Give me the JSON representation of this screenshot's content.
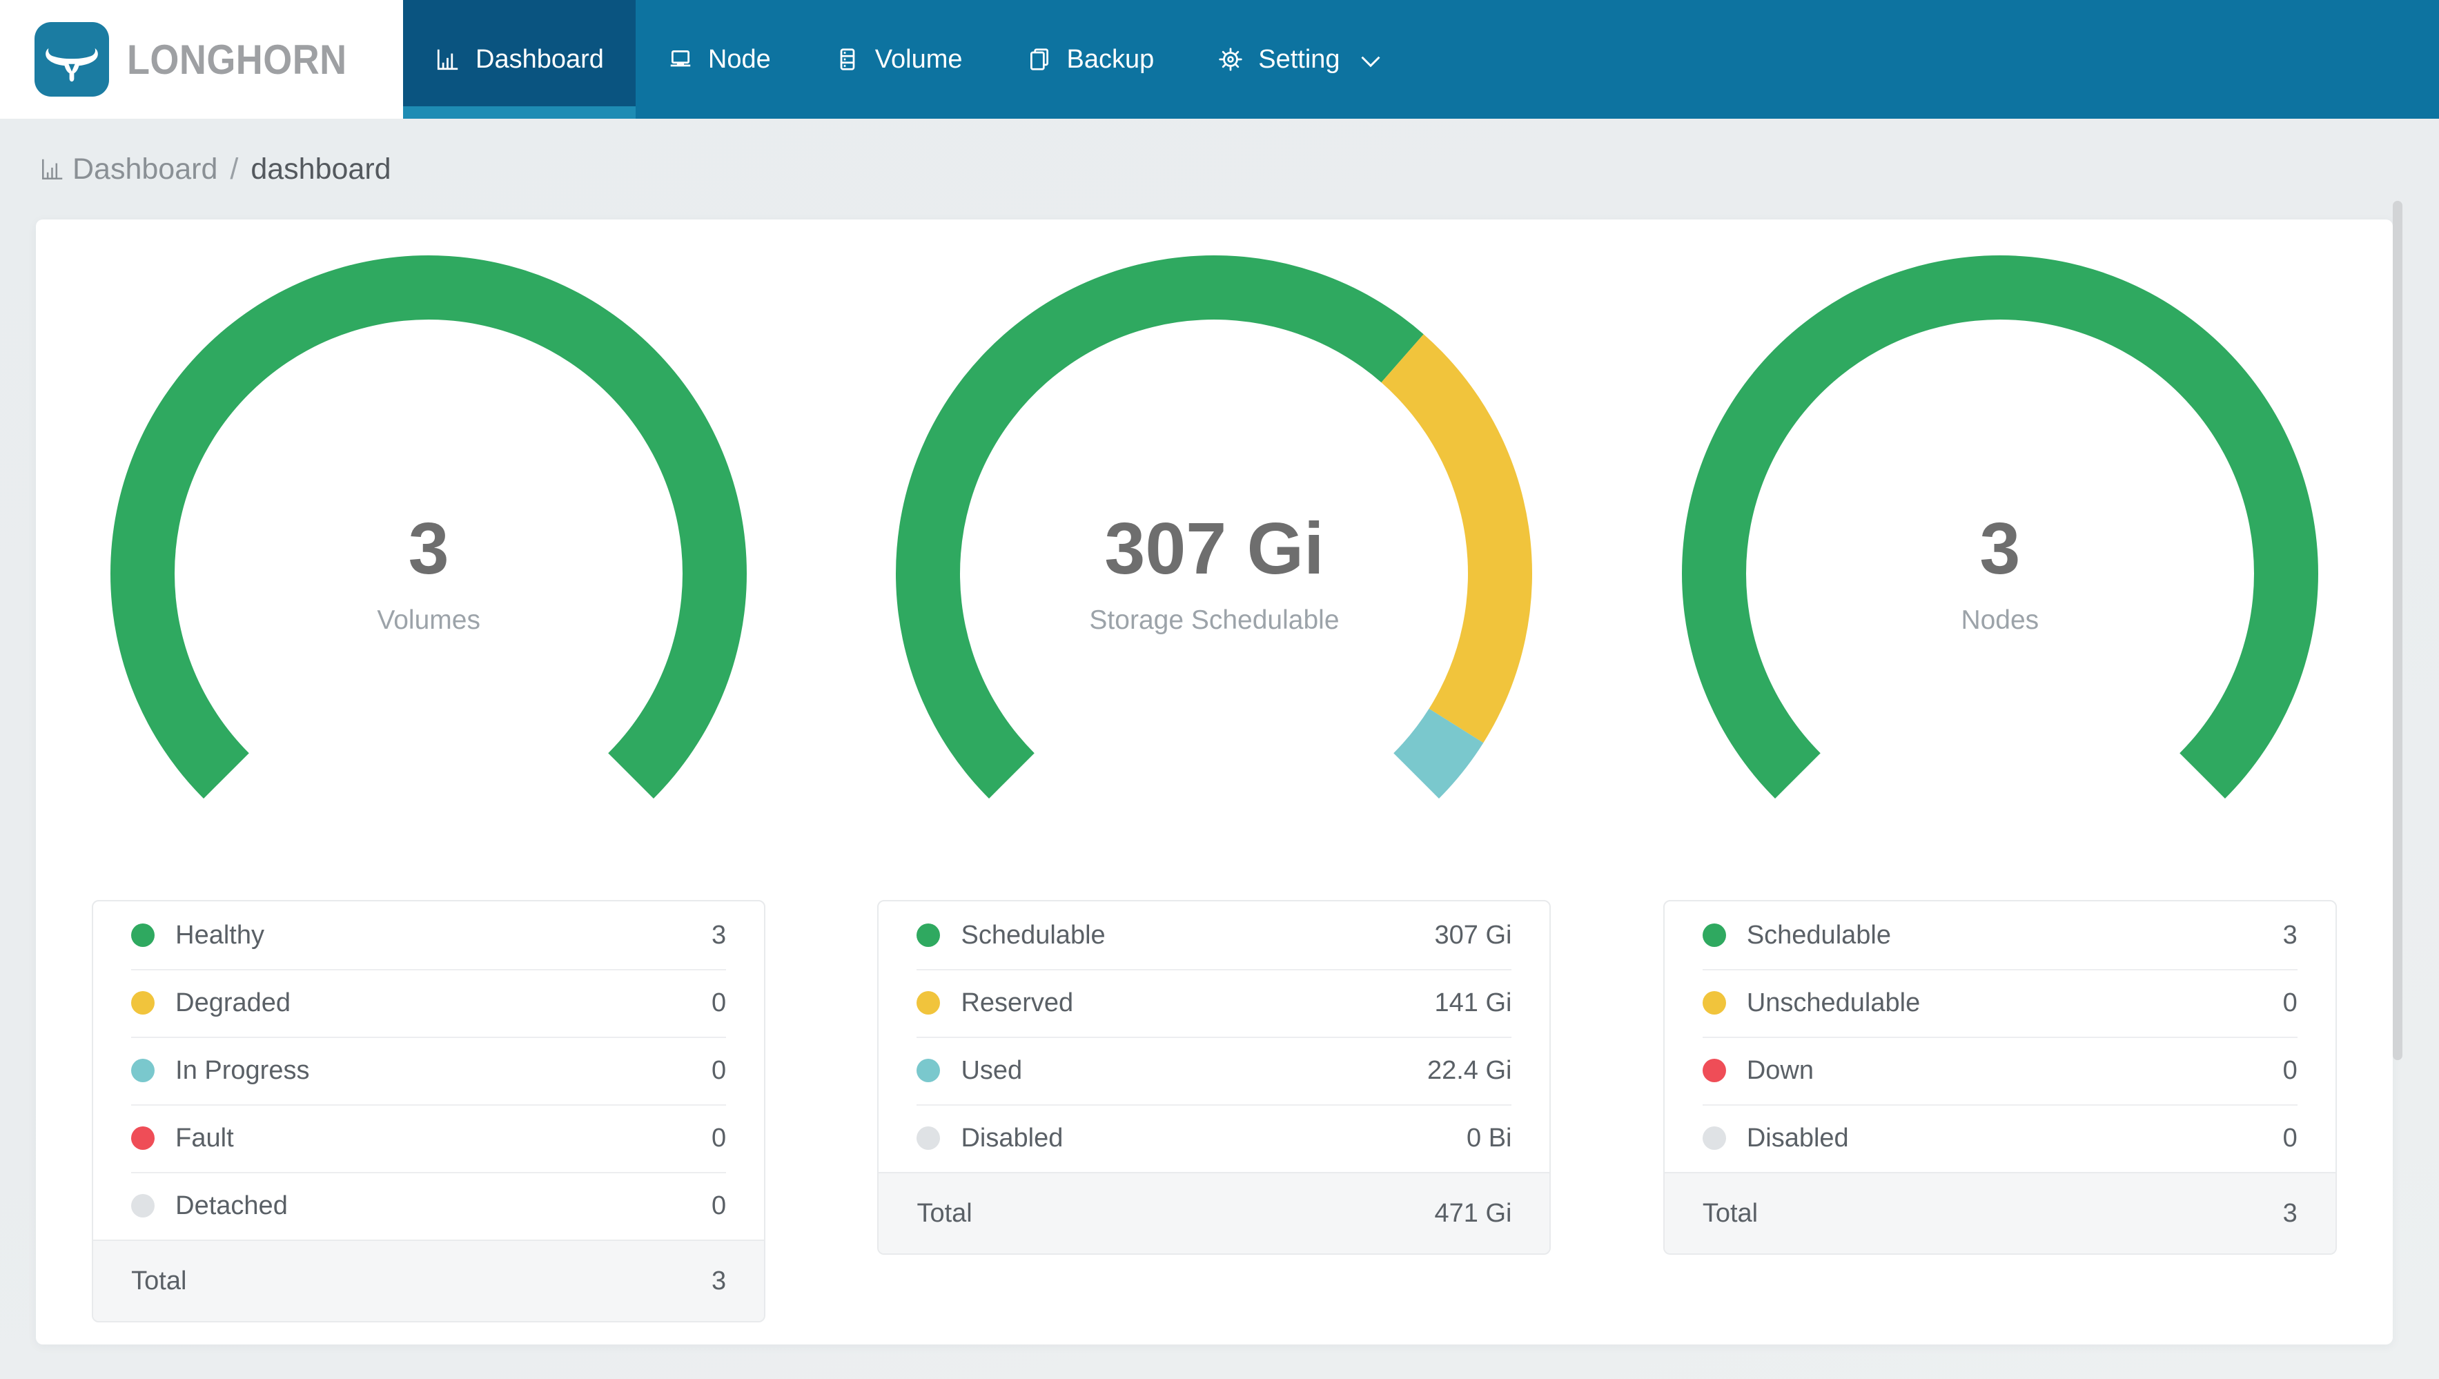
{
  "brand": {
    "name": "LONGHORN"
  },
  "nav": {
    "items": [
      {
        "label": "Dashboard",
        "icon": "bar-chart-icon",
        "active": true
      },
      {
        "label": "Node",
        "icon": "laptop-icon",
        "active": false
      },
      {
        "label": "Volume",
        "icon": "database-icon",
        "active": false
      },
      {
        "label": "Backup",
        "icon": "copy-icon",
        "active": false
      },
      {
        "label": "Setting",
        "icon": "gear-icon",
        "active": false,
        "has_dropdown": true,
        "dropdown_icon": "chevron-down-icon"
      }
    ]
  },
  "breadcrumb": {
    "icon": "bar-chart-icon",
    "section": "Dashboard",
    "separator": "/",
    "current": "dashboard"
  },
  "colors": {
    "navbar": "#0D73A0",
    "navbar_active": "#0A5480",
    "navbar_active_underline": "#1E8CB4",
    "logo_tile": "#1B7CA2",
    "page_bg": "#EAEDEF",
    "healthy_green": "#2FA960",
    "warn_yellow": "#F1C43C",
    "progress_teal": "#7AC8CD",
    "fault_red": "#EF4D57",
    "disabled_gray": "#DFE2E5"
  },
  "chart_data": [
    {
      "type": "gauge",
      "title": "Volumes",
      "center_value": "3",
      "center_label": "Volumes",
      "start_angle": 225,
      "end_angle": -45,
      "legend_position": "bottom",
      "segments": [
        {
          "label": "Healthy",
          "value": 3,
          "display": "3",
          "color": "#2FA960"
        },
        {
          "label": "Degraded",
          "value": 0,
          "display": "0",
          "color": "#F1C43C"
        },
        {
          "label": "In Progress",
          "value": 0,
          "display": "0",
          "color": "#7AC8CD"
        },
        {
          "label": "Fault",
          "value": 0,
          "display": "0",
          "color": "#EF4D57"
        },
        {
          "label": "Detached",
          "value": 0,
          "display": "0",
          "color": "#DFE2E5"
        }
      ],
      "total": {
        "label": "Total",
        "display": "3"
      }
    },
    {
      "type": "gauge",
      "title": "Storage Schedulable",
      "center_value": "307 Gi",
      "center_label": "Storage Schedulable",
      "start_angle": 225,
      "end_angle": -45,
      "legend_position": "bottom",
      "segments": [
        {
          "label": "Schedulable",
          "value": 307,
          "display": "307 Gi",
          "color": "#2FA960"
        },
        {
          "label": "Reserved",
          "value": 141,
          "display": "141 Gi",
          "color": "#F1C43C"
        },
        {
          "label": "Used",
          "value": 22.4,
          "display": "22.4 Gi",
          "color": "#7AC8CD"
        },
        {
          "label": "Disabled",
          "value": 0,
          "display": "0 Bi",
          "color": "#DFE2E5"
        }
      ],
      "total": {
        "label": "Total",
        "display": "471 Gi"
      }
    },
    {
      "type": "gauge",
      "title": "Nodes",
      "center_value": "3",
      "center_label": "Nodes",
      "start_angle": 225,
      "end_angle": -45,
      "legend_position": "bottom",
      "segments": [
        {
          "label": "Schedulable",
          "value": 3,
          "display": "3",
          "color": "#2FA960"
        },
        {
          "label": "Unschedulable",
          "value": 0,
          "display": "0",
          "color": "#F1C43C"
        },
        {
          "label": "Down",
          "value": 0,
          "display": "0",
          "color": "#EF4D57"
        },
        {
          "label": "Disabled",
          "value": 0,
          "display": "0",
          "color": "#DFE2E5"
        }
      ],
      "total": {
        "label": "Total",
        "display": "3"
      }
    }
  ]
}
